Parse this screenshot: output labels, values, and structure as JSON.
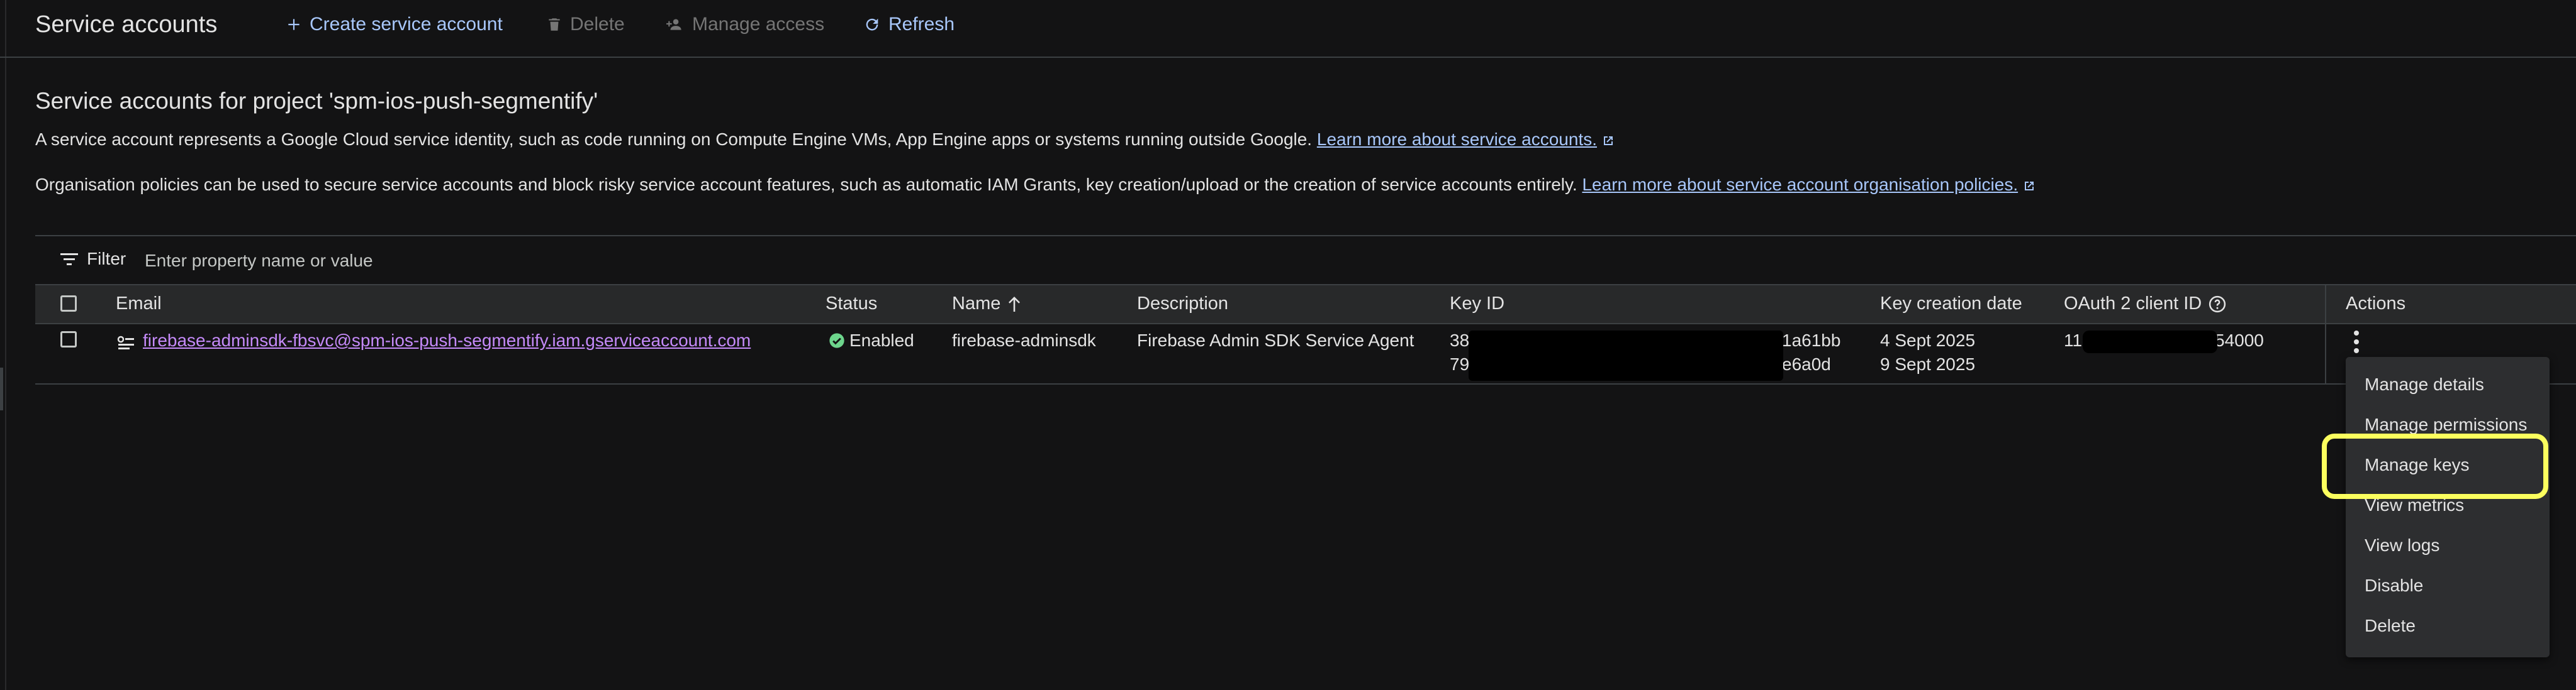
{
  "toolbar": {
    "title": "Service accounts",
    "create_label": "Create service account",
    "delete_label": "Delete",
    "manage_access_label": "Manage access",
    "refresh_label": "Refresh"
  },
  "intro": {
    "heading": "Service accounts for project 'spm-ios-push-segmentify'",
    "para1_text": "A service account represents a Google Cloud service identity, such as code running on Compute Engine VMs, App Engine apps or systems running outside Google.",
    "para1_link": "Learn more about service accounts.",
    "para2_text": "Organisation policies can be used to secure service accounts and block risky service account features, such as automatic IAM Grants, key creation/upload or the creation of service accounts entirely.",
    "para2_link": "Learn more about service account organisation policies."
  },
  "filter": {
    "label": "Filter",
    "placeholder": "Enter property name or value"
  },
  "table": {
    "headers": {
      "email": "Email",
      "status": "Status",
      "name": "Name",
      "description": "Description",
      "key_id": "Key ID",
      "key_creation_date": "Key creation date",
      "oauth": "OAuth 2 client ID",
      "actions": "Actions"
    },
    "rows": [
      {
        "email": "firebase-adminsdk-fbsvc@spm-ios-push-segmentify.iam.gserviceaccount.com",
        "status": "Enabled",
        "name": "firebase-adminsdk",
        "description": "Firebase Admin SDK Service Agent",
        "key_id_1_start": "38",
        "key_id_1_end": "1a61bb",
        "key_id_2_start": "79",
        "key_id_2_end": "e6a0d",
        "key_date_1": "4 Sept 2025",
        "key_date_2": "9 Sept 2025",
        "oauth_start": "11",
        "oauth_end": "54000"
      }
    ]
  },
  "menu": {
    "items": [
      "Manage details",
      "Manage permissions",
      "Manage keys",
      "View metrics",
      "View logs",
      "Disable",
      "Delete"
    ]
  },
  "colors": {
    "background": "#131314",
    "link": "#a8c7fa",
    "email_link": "#c58af9",
    "status_ok": "#6dd58c",
    "highlight": "#fbff5e"
  }
}
